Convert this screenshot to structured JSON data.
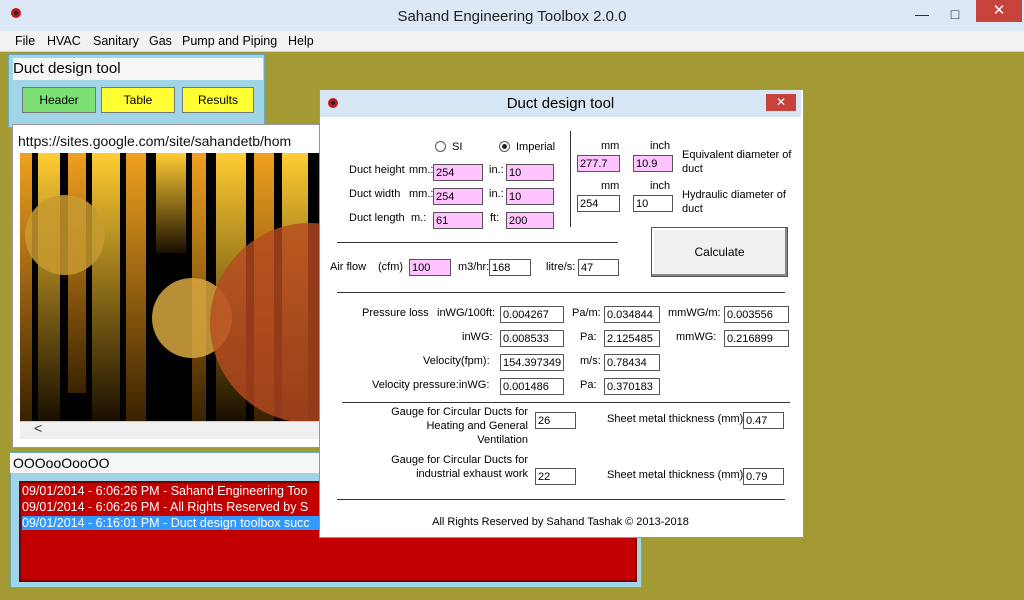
{
  "app": {
    "title": "Sahand Engineering Toolbox 2.0.0"
  },
  "menu": [
    "File",
    "HVAC",
    "Sanitary",
    "Gas",
    "Pump and Piping",
    "Help"
  ],
  "left": {
    "panel_title": "Duct design tool",
    "buttons": {
      "header": "Header",
      "table": "Table",
      "results": "Results"
    },
    "url": "https://sites.google.com/site/sahandetb/hom",
    "scroll_left": "<"
  },
  "log": {
    "title": "OOOooOooOO",
    "lines": [
      "09/01/2014 - 6:06:26 PM - Sahand Engineering Too",
      "09/01/2014 - 6:06:26 PM - All Rights Reserved by S",
      "09/01/2014 - 6:16:01 PM - Duct design toolbox succ"
    ]
  },
  "dialog": {
    "title": "Duct design tool",
    "units": {
      "si": "SI",
      "imperial": "Imperial",
      "selected": "Imperial"
    },
    "inputs": {
      "height": {
        "label": "Duct height",
        "si_unit": "mm.:",
        "si_value": "254",
        "imp_unit": "in.:",
        "imp_value": "10"
      },
      "width": {
        "label": "Duct width",
        "si_unit": "mm.:",
        "si_value": "254",
        "imp_unit": "in.:",
        "imp_value": "10"
      },
      "length": {
        "label": "Duct length",
        "si_unit": "m.:",
        "si_value": "61",
        "imp_unit": "ft:",
        "imp_value": "200"
      }
    },
    "diameters": {
      "mm_label": "mm",
      "inch_label": "inch",
      "equivalent": {
        "label": "Equivalent diameter of duct",
        "mm": "277.7",
        "inch": "10.9"
      },
      "hydraulic": {
        "label": "Hydraulic diameter of duct",
        "mm": "254",
        "inch": "10"
      }
    },
    "calculate": "Calculate",
    "airflow": {
      "label": "Air flow",
      "cfm_label": "(cfm)",
      "cfm": "100",
      "m3hr_label": "m3/hr:",
      "m3hr": "168",
      "ls_label": "litre/s:",
      "ls": "47"
    },
    "results": {
      "pressure_loss_label": "Pressure loss",
      "inwg100_label": "inWG/100ft:",
      "inwg100": "0.004267",
      "pam_label": "Pa/m:",
      "pam": "0.034844",
      "mmwgm_label": "mmWG/m:",
      "mmwgm": "0.003556",
      "inwg_label": "inWG:",
      "inwg": "0.008533",
      "pa_label": "Pa:",
      "pa": "2.125485",
      "mmwg_label": "mmWG:",
      "mmwg": "0.216899",
      "velocity_label": "Velocity(fpm):",
      "velocity": "154.397349",
      "ms_label": "m/s:",
      "ms": "0.78434",
      "vp_label": "Velocity pressure:inWG:",
      "vp": "0.001486",
      "vp_pa_label": "Pa:",
      "vp_pa": "0.370183"
    },
    "gauge": {
      "hvac_label_1": "Gauge for Circular Ducts for",
      "hvac_label_2": "Heating and General",
      "hvac_label_3": "Ventilation",
      "hvac_value": "26",
      "hvac_thickness_label": "Sheet metal thickness (mm):",
      "hvac_thickness": "0.47",
      "ind_label_1": "Gauge for Circular Ducts for",
      "ind_label_2": "industrial exhaust work",
      "ind_value": "22",
      "ind_thickness_label": "Sheet metal thickness (mm):",
      "ind_thickness": "0.79"
    },
    "footer": "All Rights Reserved by Sahand Tashak © 2013-2018"
  },
  "icons": [
    "app-icon",
    "minimize-icon",
    "maximize-icon",
    "close-icon"
  ],
  "colors": {
    "desktop": "#a39a33",
    "log_bg": "#c20000",
    "pink_field": "#ffc4ff",
    "yellow_button": "#ffff33",
    "green_button": "#7de074"
  }
}
